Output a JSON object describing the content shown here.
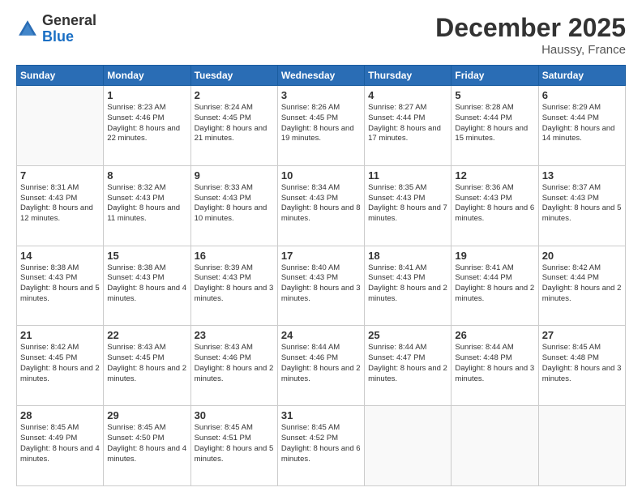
{
  "header": {
    "logo_general": "General",
    "logo_blue": "Blue",
    "month_title": "December 2025",
    "location": "Haussy, France"
  },
  "weekdays": [
    "Sunday",
    "Monday",
    "Tuesday",
    "Wednesday",
    "Thursday",
    "Friday",
    "Saturday"
  ],
  "weeks": [
    [
      {
        "day": "",
        "sunrise": "",
        "sunset": "",
        "daylight": ""
      },
      {
        "day": "1",
        "sunrise": "Sunrise: 8:23 AM",
        "sunset": "Sunset: 4:46 PM",
        "daylight": "Daylight: 8 hours and 22 minutes."
      },
      {
        "day": "2",
        "sunrise": "Sunrise: 8:24 AM",
        "sunset": "Sunset: 4:45 PM",
        "daylight": "Daylight: 8 hours and 21 minutes."
      },
      {
        "day": "3",
        "sunrise": "Sunrise: 8:26 AM",
        "sunset": "Sunset: 4:45 PM",
        "daylight": "Daylight: 8 hours and 19 minutes."
      },
      {
        "day": "4",
        "sunrise": "Sunrise: 8:27 AM",
        "sunset": "Sunset: 4:44 PM",
        "daylight": "Daylight: 8 hours and 17 minutes."
      },
      {
        "day": "5",
        "sunrise": "Sunrise: 8:28 AM",
        "sunset": "Sunset: 4:44 PM",
        "daylight": "Daylight: 8 hours and 15 minutes."
      },
      {
        "day": "6",
        "sunrise": "Sunrise: 8:29 AM",
        "sunset": "Sunset: 4:44 PM",
        "daylight": "Daylight: 8 hours and 14 minutes."
      }
    ],
    [
      {
        "day": "7",
        "sunrise": "Sunrise: 8:31 AM",
        "sunset": "Sunset: 4:43 PM",
        "daylight": "Daylight: 8 hours and 12 minutes."
      },
      {
        "day": "8",
        "sunrise": "Sunrise: 8:32 AM",
        "sunset": "Sunset: 4:43 PM",
        "daylight": "Daylight: 8 hours and 11 minutes."
      },
      {
        "day": "9",
        "sunrise": "Sunrise: 8:33 AM",
        "sunset": "Sunset: 4:43 PM",
        "daylight": "Daylight: 8 hours and 10 minutes."
      },
      {
        "day": "10",
        "sunrise": "Sunrise: 8:34 AM",
        "sunset": "Sunset: 4:43 PM",
        "daylight": "Daylight: 8 hours and 8 minutes."
      },
      {
        "day": "11",
        "sunrise": "Sunrise: 8:35 AM",
        "sunset": "Sunset: 4:43 PM",
        "daylight": "Daylight: 8 hours and 7 minutes."
      },
      {
        "day": "12",
        "sunrise": "Sunrise: 8:36 AM",
        "sunset": "Sunset: 4:43 PM",
        "daylight": "Daylight: 8 hours and 6 minutes."
      },
      {
        "day": "13",
        "sunrise": "Sunrise: 8:37 AM",
        "sunset": "Sunset: 4:43 PM",
        "daylight": "Daylight: 8 hours and 5 minutes."
      }
    ],
    [
      {
        "day": "14",
        "sunrise": "Sunrise: 8:38 AM",
        "sunset": "Sunset: 4:43 PM",
        "daylight": "Daylight: 8 hours and 5 minutes."
      },
      {
        "day": "15",
        "sunrise": "Sunrise: 8:38 AM",
        "sunset": "Sunset: 4:43 PM",
        "daylight": "Daylight: 8 hours and 4 minutes."
      },
      {
        "day": "16",
        "sunrise": "Sunrise: 8:39 AM",
        "sunset": "Sunset: 4:43 PM",
        "daylight": "Daylight: 8 hours and 3 minutes."
      },
      {
        "day": "17",
        "sunrise": "Sunrise: 8:40 AM",
        "sunset": "Sunset: 4:43 PM",
        "daylight": "Daylight: 8 hours and 3 minutes."
      },
      {
        "day": "18",
        "sunrise": "Sunrise: 8:41 AM",
        "sunset": "Sunset: 4:43 PM",
        "daylight": "Daylight: 8 hours and 2 minutes."
      },
      {
        "day": "19",
        "sunrise": "Sunrise: 8:41 AM",
        "sunset": "Sunset: 4:44 PM",
        "daylight": "Daylight: 8 hours and 2 minutes."
      },
      {
        "day": "20",
        "sunrise": "Sunrise: 8:42 AM",
        "sunset": "Sunset: 4:44 PM",
        "daylight": "Daylight: 8 hours and 2 minutes."
      }
    ],
    [
      {
        "day": "21",
        "sunrise": "Sunrise: 8:42 AM",
        "sunset": "Sunset: 4:45 PM",
        "daylight": "Daylight: 8 hours and 2 minutes."
      },
      {
        "day": "22",
        "sunrise": "Sunrise: 8:43 AM",
        "sunset": "Sunset: 4:45 PM",
        "daylight": "Daylight: 8 hours and 2 minutes."
      },
      {
        "day": "23",
        "sunrise": "Sunrise: 8:43 AM",
        "sunset": "Sunset: 4:46 PM",
        "daylight": "Daylight: 8 hours and 2 minutes."
      },
      {
        "day": "24",
        "sunrise": "Sunrise: 8:44 AM",
        "sunset": "Sunset: 4:46 PM",
        "daylight": "Daylight: 8 hours and 2 minutes."
      },
      {
        "day": "25",
        "sunrise": "Sunrise: 8:44 AM",
        "sunset": "Sunset: 4:47 PM",
        "daylight": "Daylight: 8 hours and 2 minutes."
      },
      {
        "day": "26",
        "sunrise": "Sunrise: 8:44 AM",
        "sunset": "Sunset: 4:48 PM",
        "daylight": "Daylight: 8 hours and 3 minutes."
      },
      {
        "day": "27",
        "sunrise": "Sunrise: 8:45 AM",
        "sunset": "Sunset: 4:48 PM",
        "daylight": "Daylight: 8 hours and 3 minutes."
      }
    ],
    [
      {
        "day": "28",
        "sunrise": "Sunrise: 8:45 AM",
        "sunset": "Sunset: 4:49 PM",
        "daylight": "Daylight: 8 hours and 4 minutes."
      },
      {
        "day": "29",
        "sunrise": "Sunrise: 8:45 AM",
        "sunset": "Sunset: 4:50 PM",
        "daylight": "Daylight: 8 hours and 4 minutes."
      },
      {
        "day": "30",
        "sunrise": "Sunrise: 8:45 AM",
        "sunset": "Sunset: 4:51 PM",
        "daylight": "Daylight: 8 hours and 5 minutes."
      },
      {
        "day": "31",
        "sunrise": "Sunrise: 8:45 AM",
        "sunset": "Sunset: 4:52 PM",
        "daylight": "Daylight: 8 hours and 6 minutes."
      },
      {
        "day": "",
        "sunrise": "",
        "sunset": "",
        "daylight": ""
      },
      {
        "day": "",
        "sunrise": "",
        "sunset": "",
        "daylight": ""
      },
      {
        "day": "",
        "sunrise": "",
        "sunset": "",
        "daylight": ""
      }
    ]
  ]
}
